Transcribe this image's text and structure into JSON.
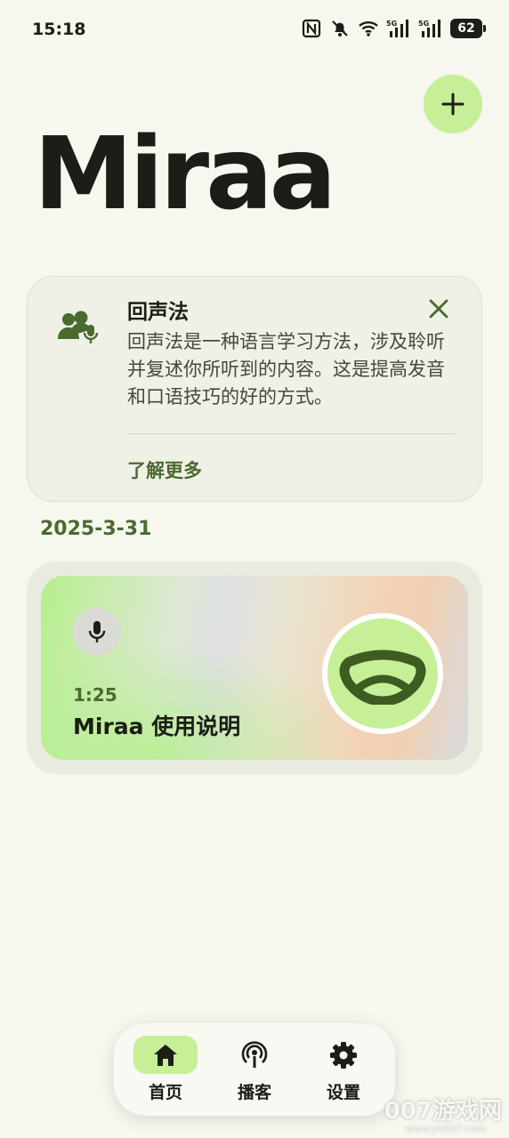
{
  "status_bar": {
    "time": "15:18",
    "battery": "62",
    "icons": [
      "nfc-icon",
      "bell-muted-icon",
      "wifi-icon",
      "signal-5g-icon",
      "signal-5g-icon"
    ]
  },
  "header": {
    "title": "Miraa",
    "add_icon": "plus-icon"
  },
  "info_card": {
    "icon": "people-mic-icon",
    "title": "回声法",
    "body": "回声法是一种语言学习方法，涉及聆听并复述你所听到的内容。这是提高发音和口语技巧的好的方式。",
    "link": "了解更多",
    "close_icon": "close-icon"
  },
  "feed": {
    "date": "2025-3-31",
    "items": [
      {
        "duration": "1:25",
        "title": "Miraa 使用说明",
        "icon": "mic-icon"
      }
    ]
  },
  "bottom_nav": {
    "items": [
      {
        "label": "首页",
        "icon": "home-icon",
        "active": true
      },
      {
        "label": "播客",
        "icon": "podcast-icon",
        "active": false
      },
      {
        "label": "设置",
        "icon": "gear-icon",
        "active": false
      }
    ]
  },
  "watermark": {
    "text": "007游戏网",
    "url": "www.yx007.com"
  },
  "colors": {
    "background": "#f6f7ee",
    "accent": "#c6ef98",
    "accent_dark": "#4a6a30",
    "text": "#1b1d17"
  }
}
